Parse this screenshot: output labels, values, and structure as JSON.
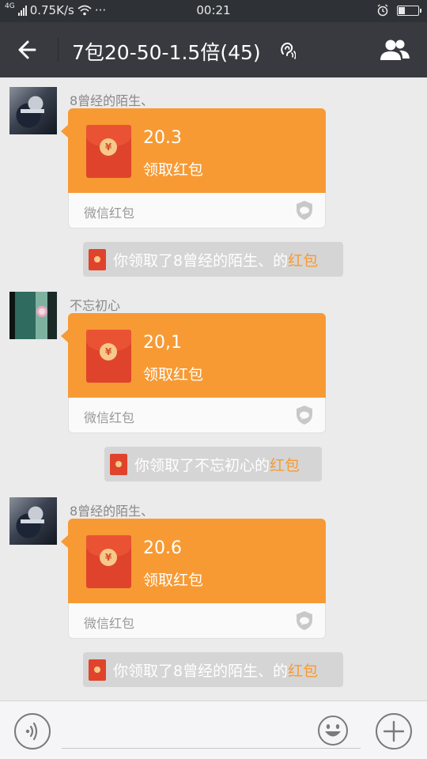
{
  "status_bar": {
    "network_type": "4G",
    "speed": "0.75K/s",
    "more": "···",
    "time": "00:21",
    "battery_level": 0.35
  },
  "nav": {
    "title": "7包20-50-1.5倍(45)",
    "icons": {
      "back": "arrow-left-icon",
      "earpiece": "ear-icon",
      "members": "group-members-icon"
    }
  },
  "messages": [
    {
      "sender": "8曾经的陌生、",
      "avatar": "avatar-a",
      "packet": {
        "amount": "20.3",
        "action": "领取红包",
        "brand": "微信红包",
        "coin": "¥"
      },
      "notice": {
        "prefix": "你领取了8曾经的陌生、的",
        "link": "红包"
      }
    },
    {
      "sender": "不忘初心",
      "avatar": "avatar-b",
      "packet": {
        "amount": "20,1",
        "action": "领取红包",
        "brand": "微信红包",
        "coin": "¥"
      },
      "notice": {
        "prefix": "你领取了不忘初心的",
        "link": "红包"
      }
    },
    {
      "sender": "8曾经的陌生、",
      "avatar": "avatar-a",
      "packet": {
        "amount": "20.6",
        "action": "领取红包",
        "brand": "微信红包",
        "coin": "¥"
      },
      "notice": {
        "prefix": "你领取了8曾经的陌生、的",
        "link": "红包"
      }
    }
  ],
  "input_bar": {
    "icons": {
      "voice": "voice-icon",
      "emoji": "emoji-icon",
      "plus": "plus-icon"
    }
  },
  "colors": {
    "nav_bg": "#393a3f",
    "packet_orange": "#f79a34",
    "envelope_red": "#e0432b",
    "chat_bg": "#ebebeb"
  }
}
